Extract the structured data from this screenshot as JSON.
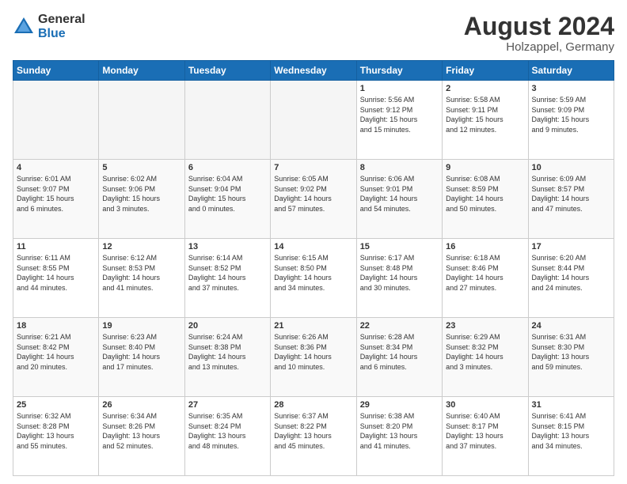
{
  "logo": {
    "general": "General",
    "blue": "Blue"
  },
  "header": {
    "month_year": "August 2024",
    "location": "Holzappel, Germany"
  },
  "weekdays": [
    "Sunday",
    "Monday",
    "Tuesday",
    "Wednesday",
    "Thursday",
    "Friday",
    "Saturday"
  ],
  "weeks": [
    [
      {
        "day": "",
        "info": ""
      },
      {
        "day": "",
        "info": ""
      },
      {
        "day": "",
        "info": ""
      },
      {
        "day": "",
        "info": ""
      },
      {
        "day": "1",
        "info": "Sunrise: 5:56 AM\nSunset: 9:12 PM\nDaylight: 15 hours\nand 15 minutes."
      },
      {
        "day": "2",
        "info": "Sunrise: 5:58 AM\nSunset: 9:11 PM\nDaylight: 15 hours\nand 12 minutes."
      },
      {
        "day": "3",
        "info": "Sunrise: 5:59 AM\nSunset: 9:09 PM\nDaylight: 15 hours\nand 9 minutes."
      }
    ],
    [
      {
        "day": "4",
        "info": "Sunrise: 6:01 AM\nSunset: 9:07 PM\nDaylight: 15 hours\nand 6 minutes."
      },
      {
        "day": "5",
        "info": "Sunrise: 6:02 AM\nSunset: 9:06 PM\nDaylight: 15 hours\nand 3 minutes."
      },
      {
        "day": "6",
        "info": "Sunrise: 6:04 AM\nSunset: 9:04 PM\nDaylight: 15 hours\nand 0 minutes."
      },
      {
        "day": "7",
        "info": "Sunrise: 6:05 AM\nSunset: 9:02 PM\nDaylight: 14 hours\nand 57 minutes."
      },
      {
        "day": "8",
        "info": "Sunrise: 6:06 AM\nSunset: 9:01 PM\nDaylight: 14 hours\nand 54 minutes."
      },
      {
        "day": "9",
        "info": "Sunrise: 6:08 AM\nSunset: 8:59 PM\nDaylight: 14 hours\nand 50 minutes."
      },
      {
        "day": "10",
        "info": "Sunrise: 6:09 AM\nSunset: 8:57 PM\nDaylight: 14 hours\nand 47 minutes."
      }
    ],
    [
      {
        "day": "11",
        "info": "Sunrise: 6:11 AM\nSunset: 8:55 PM\nDaylight: 14 hours\nand 44 minutes."
      },
      {
        "day": "12",
        "info": "Sunrise: 6:12 AM\nSunset: 8:53 PM\nDaylight: 14 hours\nand 41 minutes."
      },
      {
        "day": "13",
        "info": "Sunrise: 6:14 AM\nSunset: 8:52 PM\nDaylight: 14 hours\nand 37 minutes."
      },
      {
        "day": "14",
        "info": "Sunrise: 6:15 AM\nSunset: 8:50 PM\nDaylight: 14 hours\nand 34 minutes."
      },
      {
        "day": "15",
        "info": "Sunrise: 6:17 AM\nSunset: 8:48 PM\nDaylight: 14 hours\nand 30 minutes."
      },
      {
        "day": "16",
        "info": "Sunrise: 6:18 AM\nSunset: 8:46 PM\nDaylight: 14 hours\nand 27 minutes."
      },
      {
        "day": "17",
        "info": "Sunrise: 6:20 AM\nSunset: 8:44 PM\nDaylight: 14 hours\nand 24 minutes."
      }
    ],
    [
      {
        "day": "18",
        "info": "Sunrise: 6:21 AM\nSunset: 8:42 PM\nDaylight: 14 hours\nand 20 minutes."
      },
      {
        "day": "19",
        "info": "Sunrise: 6:23 AM\nSunset: 8:40 PM\nDaylight: 14 hours\nand 17 minutes."
      },
      {
        "day": "20",
        "info": "Sunrise: 6:24 AM\nSunset: 8:38 PM\nDaylight: 14 hours\nand 13 minutes."
      },
      {
        "day": "21",
        "info": "Sunrise: 6:26 AM\nSunset: 8:36 PM\nDaylight: 14 hours\nand 10 minutes."
      },
      {
        "day": "22",
        "info": "Sunrise: 6:28 AM\nSunset: 8:34 PM\nDaylight: 14 hours\nand 6 minutes."
      },
      {
        "day": "23",
        "info": "Sunrise: 6:29 AM\nSunset: 8:32 PM\nDaylight: 14 hours\nand 3 minutes."
      },
      {
        "day": "24",
        "info": "Sunrise: 6:31 AM\nSunset: 8:30 PM\nDaylight: 13 hours\nand 59 minutes."
      }
    ],
    [
      {
        "day": "25",
        "info": "Sunrise: 6:32 AM\nSunset: 8:28 PM\nDaylight: 13 hours\nand 55 minutes."
      },
      {
        "day": "26",
        "info": "Sunrise: 6:34 AM\nSunset: 8:26 PM\nDaylight: 13 hours\nand 52 minutes."
      },
      {
        "day": "27",
        "info": "Sunrise: 6:35 AM\nSunset: 8:24 PM\nDaylight: 13 hours\nand 48 minutes."
      },
      {
        "day": "28",
        "info": "Sunrise: 6:37 AM\nSunset: 8:22 PM\nDaylight: 13 hours\nand 45 minutes."
      },
      {
        "day": "29",
        "info": "Sunrise: 6:38 AM\nSunset: 8:20 PM\nDaylight: 13 hours\nand 41 minutes."
      },
      {
        "day": "30",
        "info": "Sunrise: 6:40 AM\nSunset: 8:17 PM\nDaylight: 13 hours\nand 37 minutes."
      },
      {
        "day": "31",
        "info": "Sunrise: 6:41 AM\nSunset: 8:15 PM\nDaylight: 13 hours\nand 34 minutes."
      }
    ]
  ]
}
